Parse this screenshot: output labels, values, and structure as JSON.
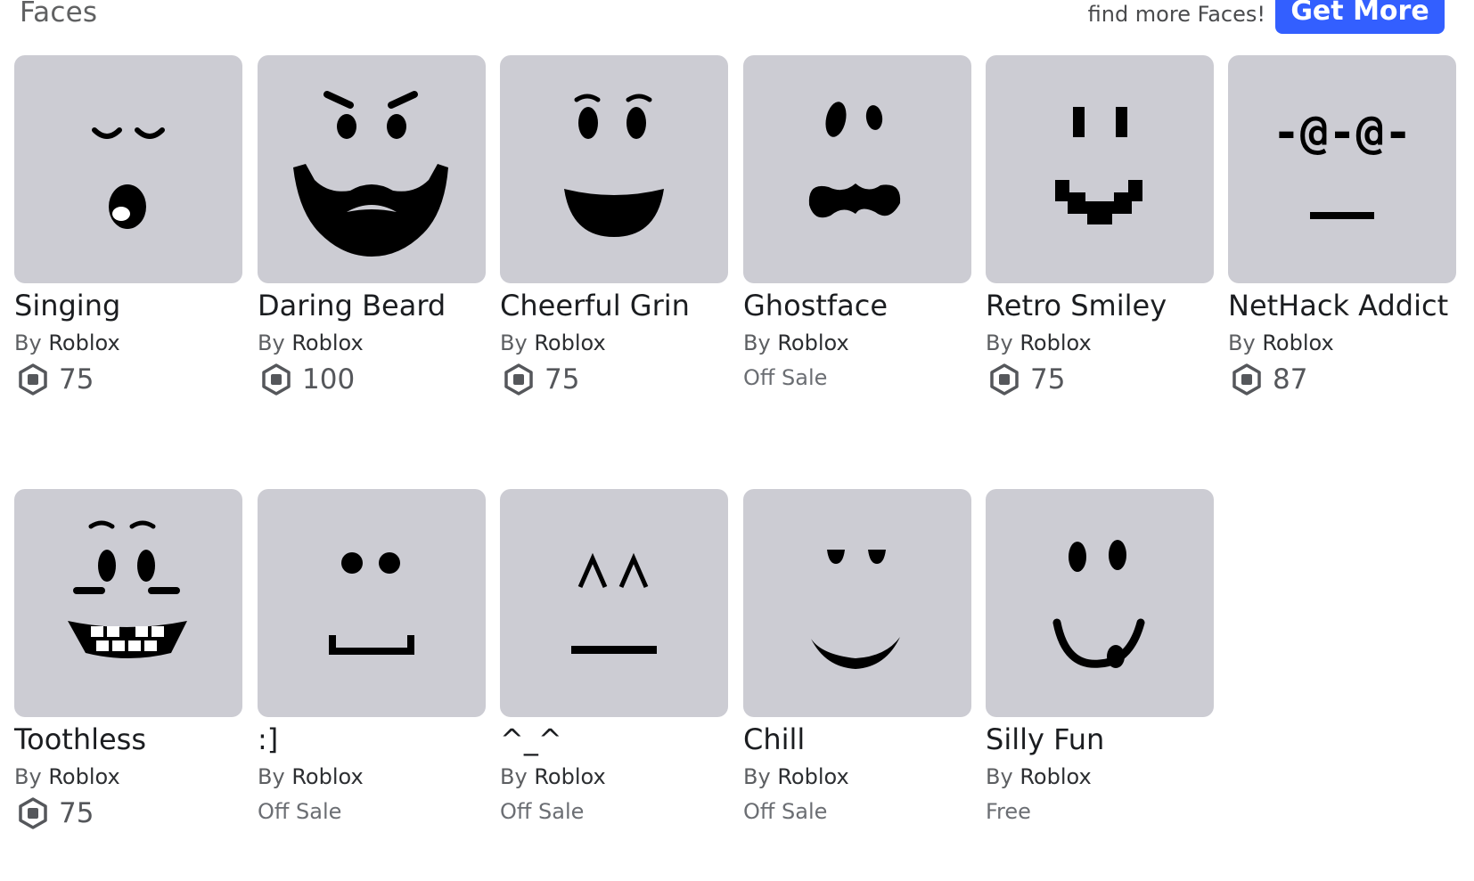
{
  "header": {
    "title": "Faces",
    "promo_text": "find more Faces!",
    "get_more_label": "Get More"
  },
  "colors": {
    "accent": "#335fff",
    "thumbnail_bg": "#ccccd3",
    "price_text": "#55575b"
  },
  "currency_icon": "robux-icon",
  "items": [
    {
      "name": "Singing",
      "by": "By",
      "creator": "Roblox",
      "price": "75",
      "status": null,
      "face": "singing-face-icon"
    },
    {
      "name": "Daring Beard",
      "by": "By",
      "creator": "Roblox",
      "price": "100",
      "status": null,
      "face": "daring-beard-face-icon"
    },
    {
      "name": "Cheerful Grin",
      "by": "By",
      "creator": "Roblox",
      "price": "75",
      "status": null,
      "face": "cheerful-grin-face-icon"
    },
    {
      "name": "Ghostface",
      "by": "By",
      "creator": "Roblox",
      "price": null,
      "status": "Off Sale",
      "face": "ghostface-face-icon"
    },
    {
      "name": "Retro Smiley",
      "by": "By",
      "creator": "Roblox",
      "price": "75",
      "status": null,
      "face": "retro-smiley-face-icon"
    },
    {
      "name": "NetHack Addict",
      "by": "By",
      "creator": "Roblox",
      "price": "87",
      "status": null,
      "face": "nethack-addict-face-icon",
      "face_text": "-@-@-"
    },
    {
      "name": "Toothless",
      "by": "By",
      "creator": "Roblox",
      "price": "75",
      "status": null,
      "face": "toothless-face-icon"
    },
    {
      "name": ":]",
      "by": "By",
      "creator": "Roblox",
      "price": null,
      "status": "Off Sale",
      "face": "bracket-smile-face-icon"
    },
    {
      "name": "^_^",
      "by": "By",
      "creator": "Roblox",
      "price": null,
      "status": "Off Sale",
      "face": "caret-eyes-face-icon"
    },
    {
      "name": "Chill",
      "by": "By",
      "creator": "Roblox",
      "price": null,
      "status": "Off Sale",
      "face": "chill-face-icon"
    },
    {
      "name": "Silly Fun",
      "by": "By",
      "creator": "Roblox",
      "price": null,
      "status": "Free",
      "face": "silly-fun-face-icon"
    }
  ]
}
